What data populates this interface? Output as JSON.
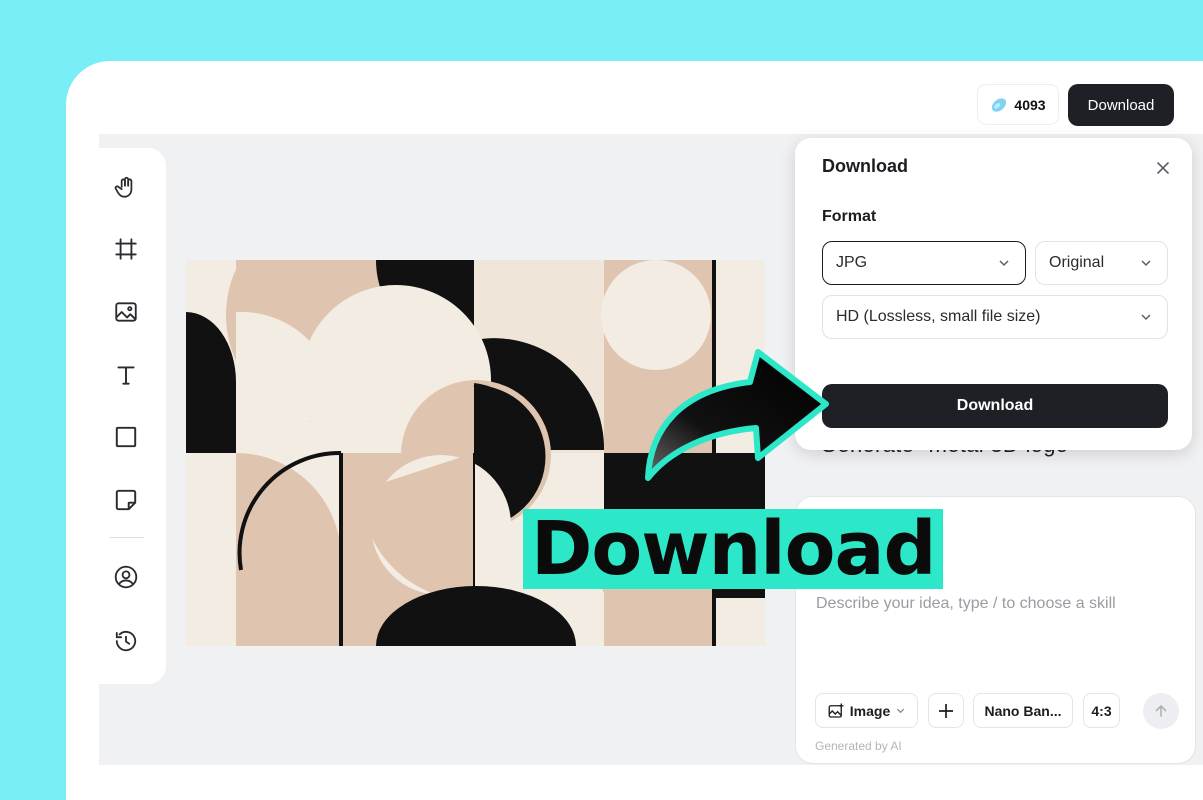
{
  "header": {
    "credits": "4093",
    "download_label": "Download"
  },
  "toolbar": {
    "tools": [
      {
        "name": "hand-icon"
      },
      {
        "name": "frame-icon"
      },
      {
        "name": "image-icon"
      },
      {
        "name": "text-icon"
      },
      {
        "name": "rectangle-icon"
      },
      {
        "name": "sticky-note-icon"
      },
      {
        "name": "user-circle-icon"
      },
      {
        "name": "history-icon"
      }
    ]
  },
  "download_panel": {
    "title": "Download",
    "format_label": "Format",
    "format_value": "JPG",
    "size_value": "Original",
    "quality_value": "HD (Lossless, small file size)",
    "download_button": "Download"
  },
  "chat": {
    "partial_message": "Generate \"metal 3D logo\"",
    "placeholder": "Describe your idea, type / to choose a skill",
    "mode_chip": "Image",
    "model_chip": "Nano Ban...",
    "ratio_chip": "4:3",
    "footer_note": "Generated by AI"
  },
  "overlay": {
    "caption": "Download"
  },
  "colors": {
    "background": "#7aeef7",
    "accent": "#2ce8c8",
    "dark": "#1f2025"
  }
}
